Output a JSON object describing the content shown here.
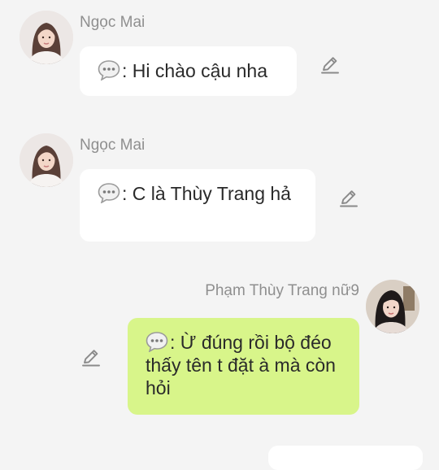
{
  "messages": [
    {
      "sender": "Ngọc Mai",
      "text": ": Hi chào cậu nha",
      "direction": "incoming",
      "avatar_icon": "female-avatar-long-hair-icon"
    },
    {
      "sender": "Ngọc Mai",
      "text": ": C là Thùy Trang hả",
      "direction": "incoming",
      "avatar_icon": "female-avatar-long-hair-icon"
    },
    {
      "sender": "Phạm Thùy Trang nữ9",
      "text": ": Ừ đúng rồi bộ đéo thấy tên t đặt à mà còn hỏi",
      "direction": "outgoing",
      "avatar_icon": "female-avatar-dark-hair-icon"
    }
  ],
  "icons": {
    "message": "speech-bubble-icon",
    "edit": "pencil-edit-icon"
  },
  "colors": {
    "background": "#f4f4f4",
    "incoming_bubble": "#ffffff",
    "outgoing_bubble": "#d8f58a",
    "sender_name": "#8f8f8f",
    "message_text": "#2a2a2a",
    "edit_icon": "#8a8a8a"
  }
}
